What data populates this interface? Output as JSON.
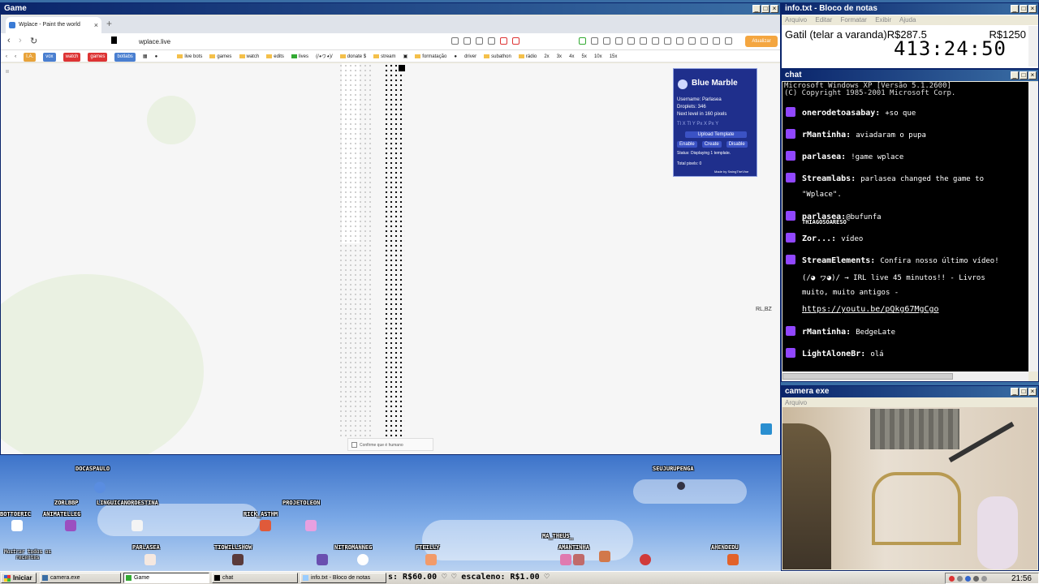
{
  "game_window": {
    "title": "Game",
    "tab_title": "Wplace - Paint the world",
    "url": "wplace.live",
    "update_button": "Atualizar",
    "bookmarks": [
      "I.A.",
      "vox",
      "watch",
      "games",
      "botlabs",
      "live bots",
      "games",
      "watch",
      "edits",
      "lives",
      "(/◕ヮ◕)/",
      "donate $",
      "stream",
      "formatação",
      "driver",
      "subathon",
      "rádio",
      "2x",
      "3x",
      "4x",
      "5x",
      "10x",
      "15x"
    ],
    "blue_marble": {
      "title": "Blue Marble",
      "username": "Username: Parlasea",
      "droplets": "Droplets: 346",
      "next_level": "Next level in 160 pixels",
      "coords": "Tl X  Tl Y  Px X  Px Y",
      "upload": "Upload Template",
      "enable": "Enable",
      "create": "Create",
      "disable": "Disable",
      "status": "Status: Displaying 1 template.",
      "total_pixels": "Total pixels: 0",
      "credit": "Made by SwingTheVine"
    },
    "captcha_text": "Confirme que é humano",
    "map_label": "RL,BZ"
  },
  "notepad": {
    "title": "info.txt - Bloco de notas",
    "menu": [
      "Arquivo",
      "Editar",
      "Formatar",
      "Exibir",
      "Ajuda"
    ],
    "line1_left": "Gatil (telar a varanda)R$287.5",
    "line1_right": "R$1250",
    "timer": "413:24:50"
  },
  "chat": {
    "title": "chat",
    "header_line1": "Microsoft Windows XP [Versão 5.1.2600]",
    "header_line2": "(C) Copyright 1985-2001 Microsoft Corp.",
    "messages": [
      {
        "user": "onerodetoasabay:",
        "text": "+so que"
      },
      {
        "user": "rMantinha:",
        "text": "aviadaram o pupa"
      },
      {
        "user": "parlasea:",
        "text": "!game wplace"
      },
      {
        "user": "Streamlabs:",
        "text": "parlasea changed the game to"
      },
      {
        "user": "",
        "text": "\"Wplace\"."
      },
      {
        "user": "parlasea:",
        "text": "@bufunfa"
      },
      {
        "user": "THIAGOSOARESO",
        "text": ""
      },
      {
        "user": "Zor...:",
        "text": "vídeo"
      },
      {
        "user": "StreamElements:",
        "text": "Confira nosso último vídeo!"
      },
      {
        "user": "",
        "text": "(/◕ ヮ◕)/ → IRL live 45 minutos!! - Livros"
      },
      {
        "user": "",
        "text": "muito, muito antigos -"
      },
      {
        "user": "",
        "text": "https://youtu.be/pQkg67MgCgo"
      },
      {
        "user": "rMantinha:",
        "text": "BedgeLate"
      },
      {
        "user": "LightAloneBr:",
        "text": "olá"
      }
    ]
  },
  "camera": {
    "title": "camera exe",
    "menu": "Arquivo"
  },
  "overlay": {
    "viewers": [
      "DOCASPAULO",
      "ZORLBBP",
      "LINGUICANORDESTINA",
      "BOTTOERIC",
      "ANIMATELLEG",
      "PROJETOLEON",
      "RICK_ASTHM",
      "PARLASEA",
      "TIOWILLSHOW",
      "NITROMANNEG",
      "FTEILLY",
      "MA_THEUS_",
      "AMANTINHA",
      "SEUJURUPENGA",
      "AHENDEDU"
    ],
    "left_caption": "Mostrar todos os recentes"
  },
  "taskbar": {
    "start": "Iniciar",
    "tasks": [
      "camera.exe",
      "Game",
      "chat",
      "info.txt - Bloco de notas"
    ],
    "ticker": "s: R$60.00 ♡   ♡ escaleno: R$1.00 ♡",
    "clock": "21:56"
  },
  "colors": {
    "xp_title": "#0a246a",
    "bluemarble_bg": "#1f2f8c",
    "twitch_badge": "#9147ff",
    "update_orange": "#f4a640"
  }
}
